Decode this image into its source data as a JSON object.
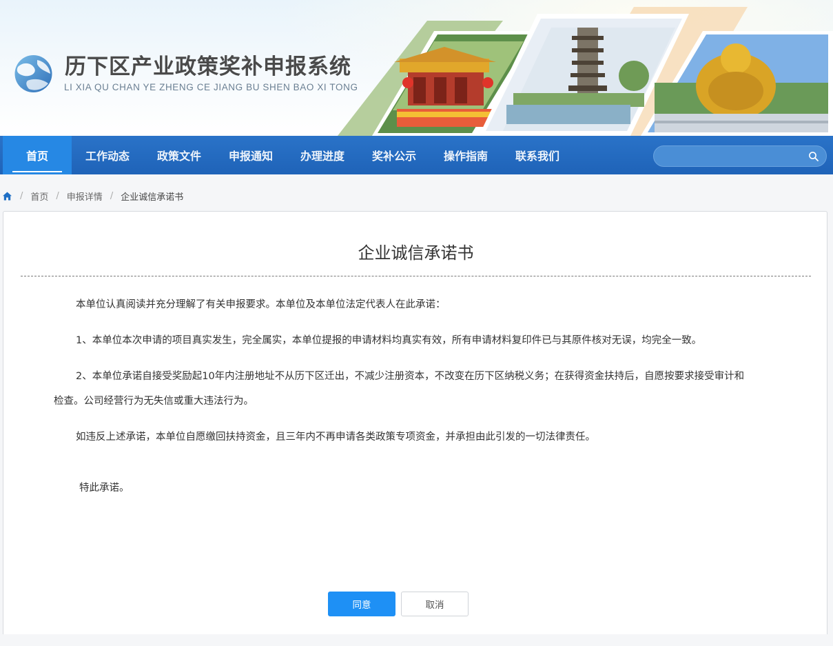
{
  "header": {
    "title": "历下区产业政策奖补申报系统",
    "subtitle": "LI XIA QU CHAN YE ZHENG CE JIANG BU SHEN BAO XI TONG",
    "logo_icon": "globe-logo-icon"
  },
  "nav": {
    "items": [
      {
        "label": "首页",
        "active": true
      },
      {
        "label": "工作动态"
      },
      {
        "label": "政策文件"
      },
      {
        "label": "申报通知"
      },
      {
        "label": "办理进度"
      },
      {
        "label": "奖补公示"
      },
      {
        "label": "操作指南"
      },
      {
        "label": "联系我们"
      }
    ],
    "search": {
      "placeholder": "",
      "value": "",
      "icon": "search-icon"
    }
  },
  "breadcrumb": {
    "home_icon": "home-icon",
    "separator": "/",
    "items": [
      "首页",
      "申报详情",
      "企业诚信承诺书"
    ]
  },
  "document": {
    "title": "企业诚信承诺书",
    "paragraphs": [
      "本单位认真阅读并充分理解了有关申报要求。本单位及本单位法定代表人在此承诺：",
      "1、本单位本次申请的项目真实发生，完全属实，本单位提报的申请材料均真实有效，所有申请材料复印件已与其原件核对无误，均完全一致。",
      "2、本单位承诺自接受奖励起10年内注册地址不从历下区迁出，不减少注册资本，不改变在历下区纳税义务；在获得资金扶持后，自愿按要求接受审计和检查。公司经营行为无失信或重大违法行为。",
      "如违反上述承诺，本单位自愿缴回扶持资金，且三年内不再申请各类政策专项资金，并承担由此引发的一切法律责任。"
    ],
    "closing": "特此承诺。"
  },
  "actions": {
    "agree_label": "同意",
    "cancel_label": "取消"
  },
  "colors": {
    "nav_bg": "#2a73c8",
    "nav_active": "#2688e4",
    "primary_button": "#1e90f5"
  }
}
